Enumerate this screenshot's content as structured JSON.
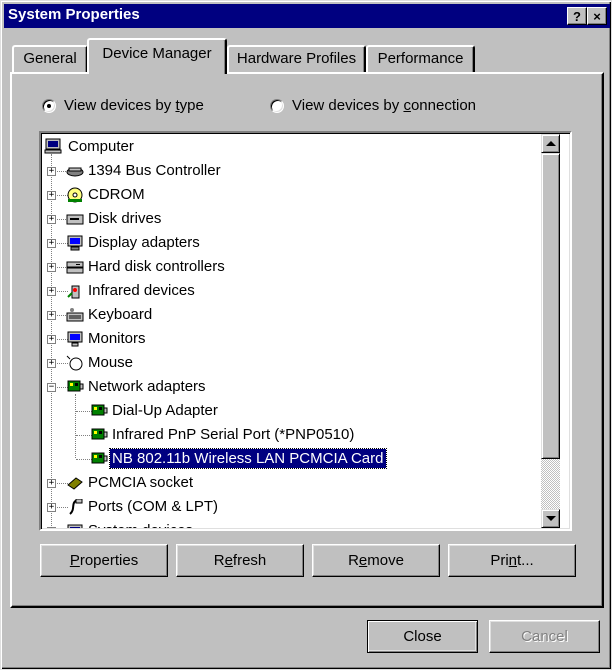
{
  "window": {
    "title": "System Properties",
    "help_glyph": "?",
    "close_glyph": "×"
  },
  "tabs": [
    {
      "label": "General",
      "active": false
    },
    {
      "label": "Device Manager",
      "active": true
    },
    {
      "label": "Hardware Profiles",
      "active": false
    },
    {
      "label": "Performance",
      "active": false
    }
  ],
  "view_options": {
    "by_type": {
      "pre": "View devices by ",
      "mnemonic": "t",
      "post": "ype",
      "checked": true
    },
    "by_connection": {
      "pre": "View devices by ",
      "mnemonic": "c",
      "post": "onnection",
      "checked": false
    }
  },
  "tree": {
    "root": {
      "label": "Computer",
      "icon": "computer-icon"
    },
    "items": [
      {
        "label": "1394 Bus Controller",
        "icon": "bus-controller-icon",
        "expander": "+"
      },
      {
        "label": "CDROM",
        "icon": "cdrom-icon",
        "expander": "+"
      },
      {
        "label": "Disk drives",
        "icon": "disk-drive-icon",
        "expander": "+"
      },
      {
        "label": "Display adapters",
        "icon": "display-adapter-icon",
        "expander": "+"
      },
      {
        "label": "Hard disk controllers",
        "icon": "hard-disk-controller-icon",
        "expander": "+"
      },
      {
        "label": "Infrared devices",
        "icon": "infrared-icon",
        "expander": "+"
      },
      {
        "label": "Keyboard",
        "icon": "keyboard-icon",
        "expander": "+"
      },
      {
        "label": "Monitors",
        "icon": "monitor-icon",
        "expander": "+"
      },
      {
        "label": "Mouse",
        "icon": "mouse-icon",
        "expander": "+"
      },
      {
        "label": "Network adapters",
        "icon": "network-adapter-icon",
        "expander": "−"
      },
      {
        "label": "PCMCIA socket",
        "icon": "pcmcia-icon",
        "expander": "+"
      },
      {
        "label": "Ports (COM & LPT)",
        "icon": "port-icon",
        "expander": "+"
      },
      {
        "label": "System devices",
        "icon": "system-device-icon",
        "expander": "+"
      }
    ],
    "network_children": [
      {
        "label": "Dial-Up Adapter",
        "icon": "network-card-icon"
      },
      {
        "label": "Infrared PnP Serial Port (*PNP0510)",
        "icon": "network-card-icon"
      },
      {
        "label": "NB 802.11b Wireless LAN PCMCIA Card",
        "icon": "network-card-icon",
        "selected": true
      }
    ]
  },
  "buttons": {
    "properties": {
      "pre": "",
      "mnemonic": "P",
      "post": "roperties"
    },
    "refresh": {
      "pre": "R",
      "mnemonic": "e",
      "post": "fresh"
    },
    "remove": {
      "pre": "R",
      "mnemonic": "e",
      "post": "move"
    },
    "print": {
      "pre": "Pri",
      "mnemonic": "n",
      "post": "t..."
    },
    "close": "Close",
    "cancel": "Cancel"
  },
  "colors": {
    "face": "#c0c0c0",
    "title_bar": "#000080",
    "selection": "#000080"
  }
}
